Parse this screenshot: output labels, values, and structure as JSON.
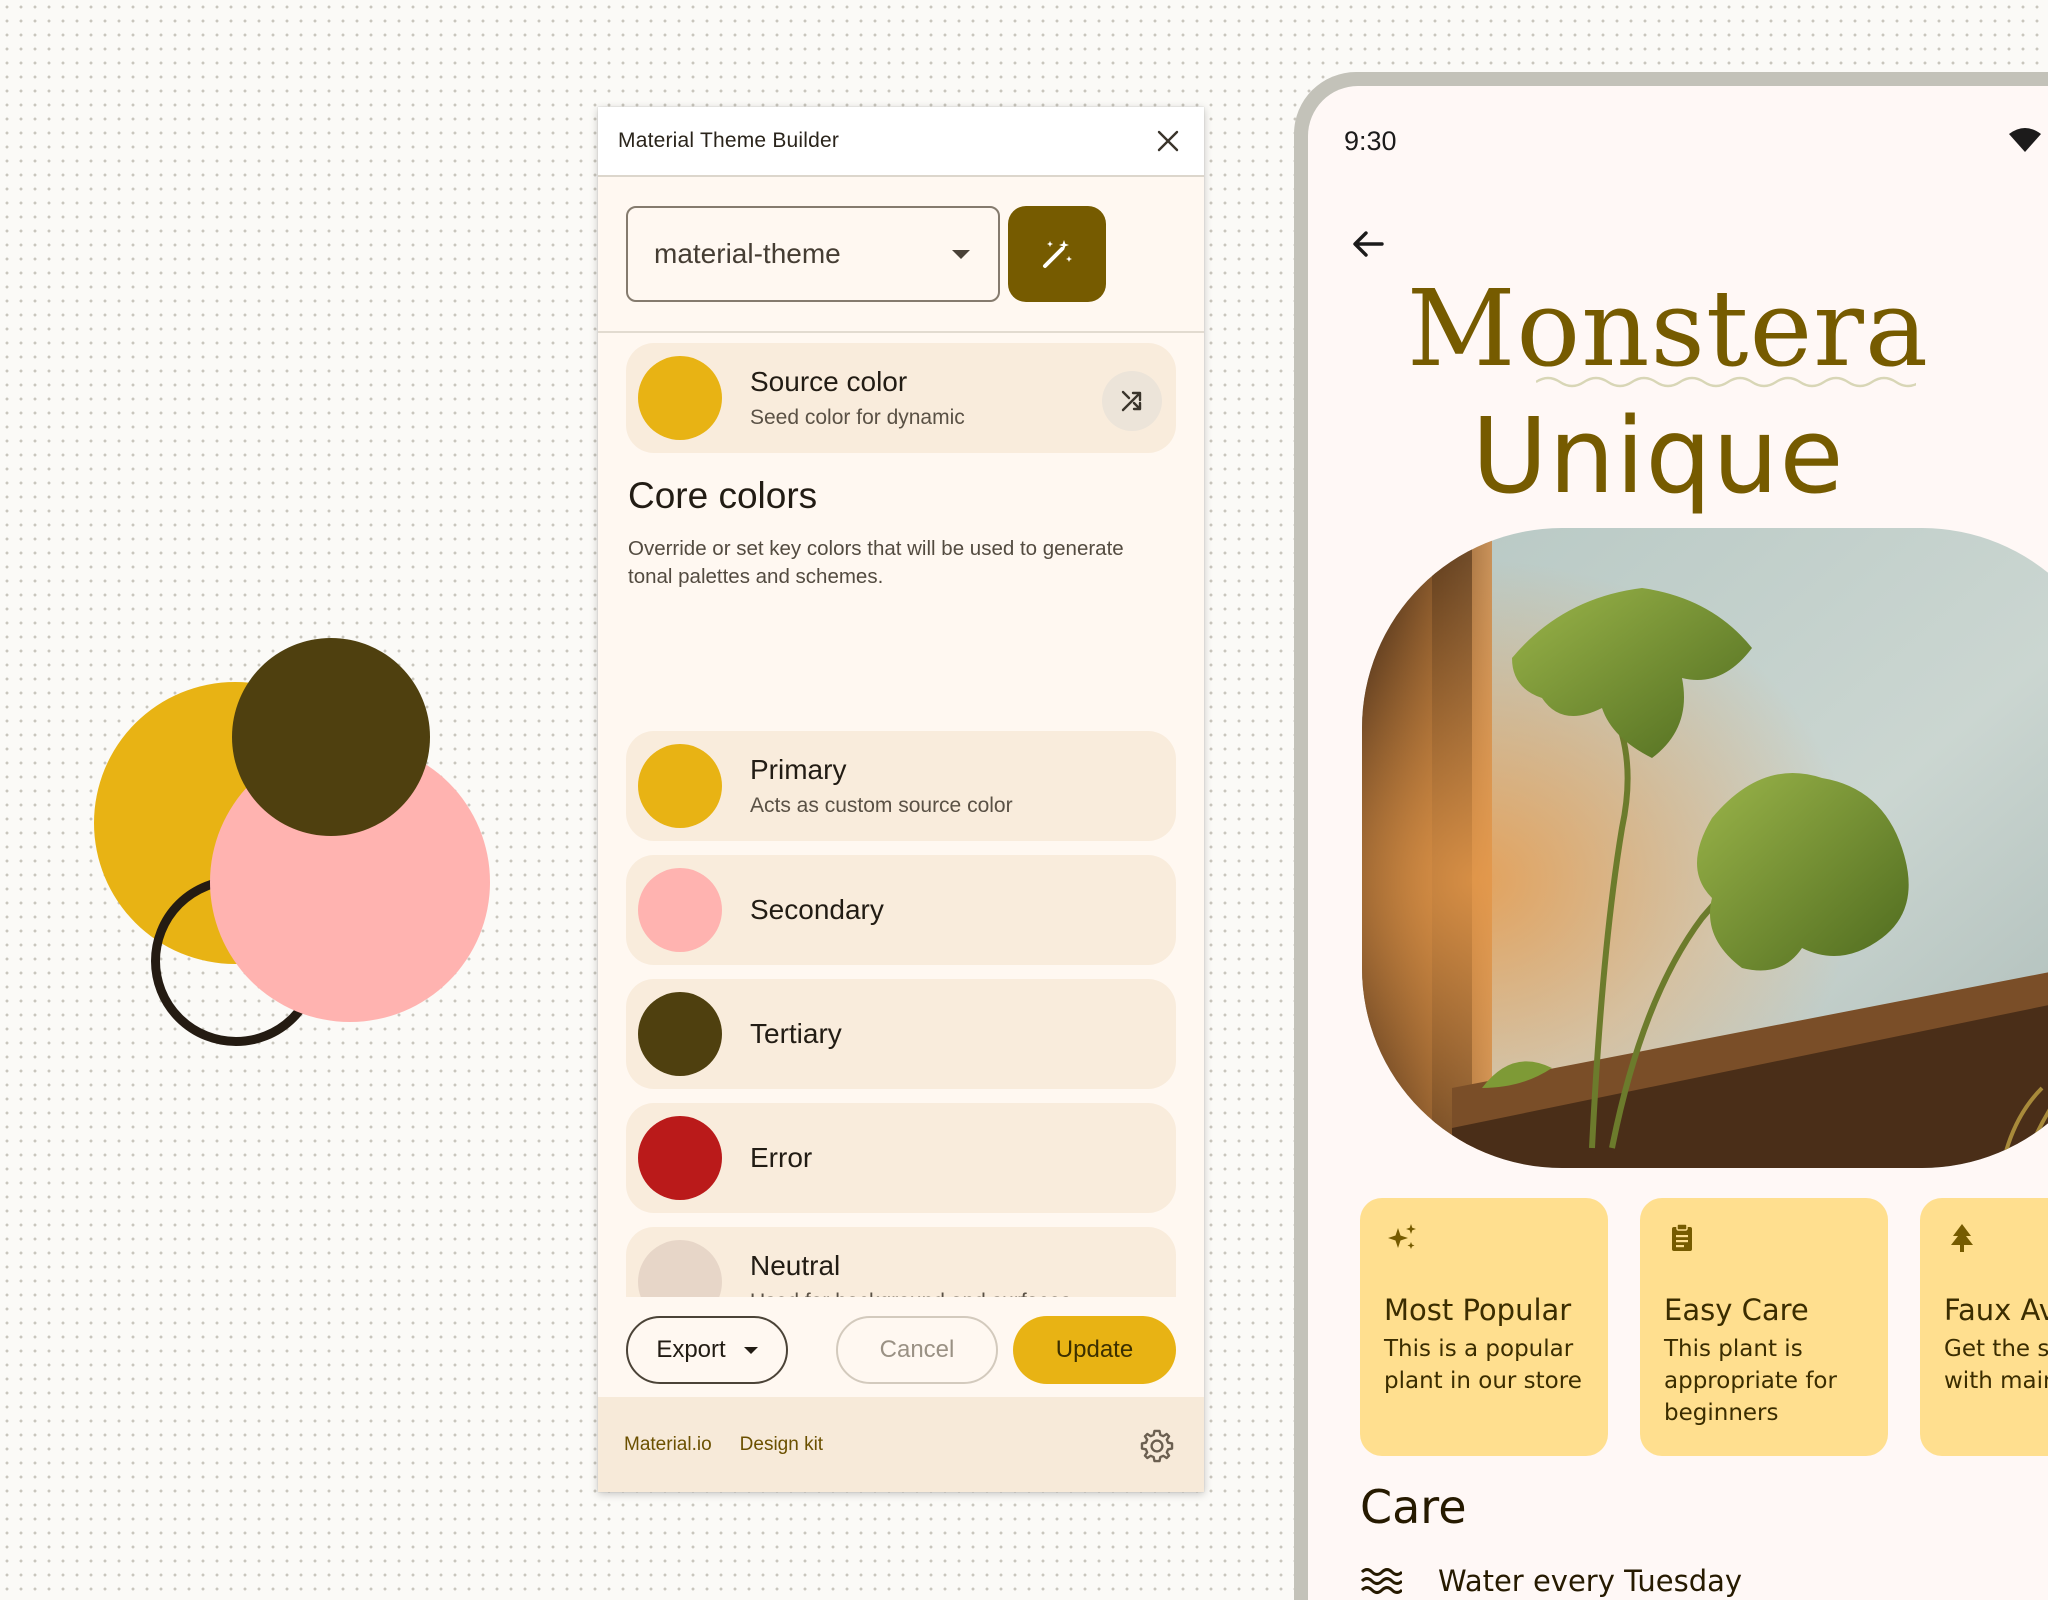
{
  "panel": {
    "title": "Material Theme Builder",
    "theme_select": {
      "value": "material-theme"
    },
    "source_color": {
      "title": "Source color",
      "subtitle": "Seed color for dynamic",
      "color": "#e8b314"
    },
    "core_colors": {
      "title": "Core colors",
      "description": "Override or set key colors that will be used to generate tonal palettes and schemes.",
      "items": [
        {
          "label": "Primary",
          "subtitle": "Acts as custom source color",
          "color": "#e8b314"
        },
        {
          "label": "Secondary",
          "subtitle": "",
          "color": "#ffb3b0"
        },
        {
          "label": "Tertiary",
          "subtitle": "",
          "color": "#4f400f"
        },
        {
          "label": "Error",
          "subtitle": "",
          "color": "#ba1a1a"
        },
        {
          "label": "Neutral",
          "subtitle": "Used for background and surfaces",
          "color": "#e7d6c8"
        }
      ]
    },
    "actions": {
      "export": "Export",
      "cancel": "Cancel",
      "update": "Update"
    },
    "footer": {
      "link1": "Material.io",
      "link2": "Design kit"
    }
  },
  "device": {
    "time": "9:30",
    "title_line1": "Monstera",
    "title_line2": "Unique",
    "chips": [
      {
        "icon": "sparkle-icon",
        "title": "Most Popular",
        "body": "This is a popular plant in our store"
      },
      {
        "icon": "clipboard-icon",
        "title": "Easy Care",
        "body": "This plant is appropriate for beginners"
      },
      {
        "icon": "tree-icon",
        "title": "Faux Av",
        "body": "Get the s look with maintena"
      }
    ],
    "care": {
      "title": "Care",
      "water": "Water every Tuesday"
    }
  },
  "colors": {
    "accent": "#765b00",
    "primary": "#e8b314",
    "secondary": "#ffb3b0",
    "tertiary": "#4f400f",
    "error": "#ba1a1a",
    "neutral": "#e7d6c8",
    "chip_bg": "#ffdf8f"
  }
}
